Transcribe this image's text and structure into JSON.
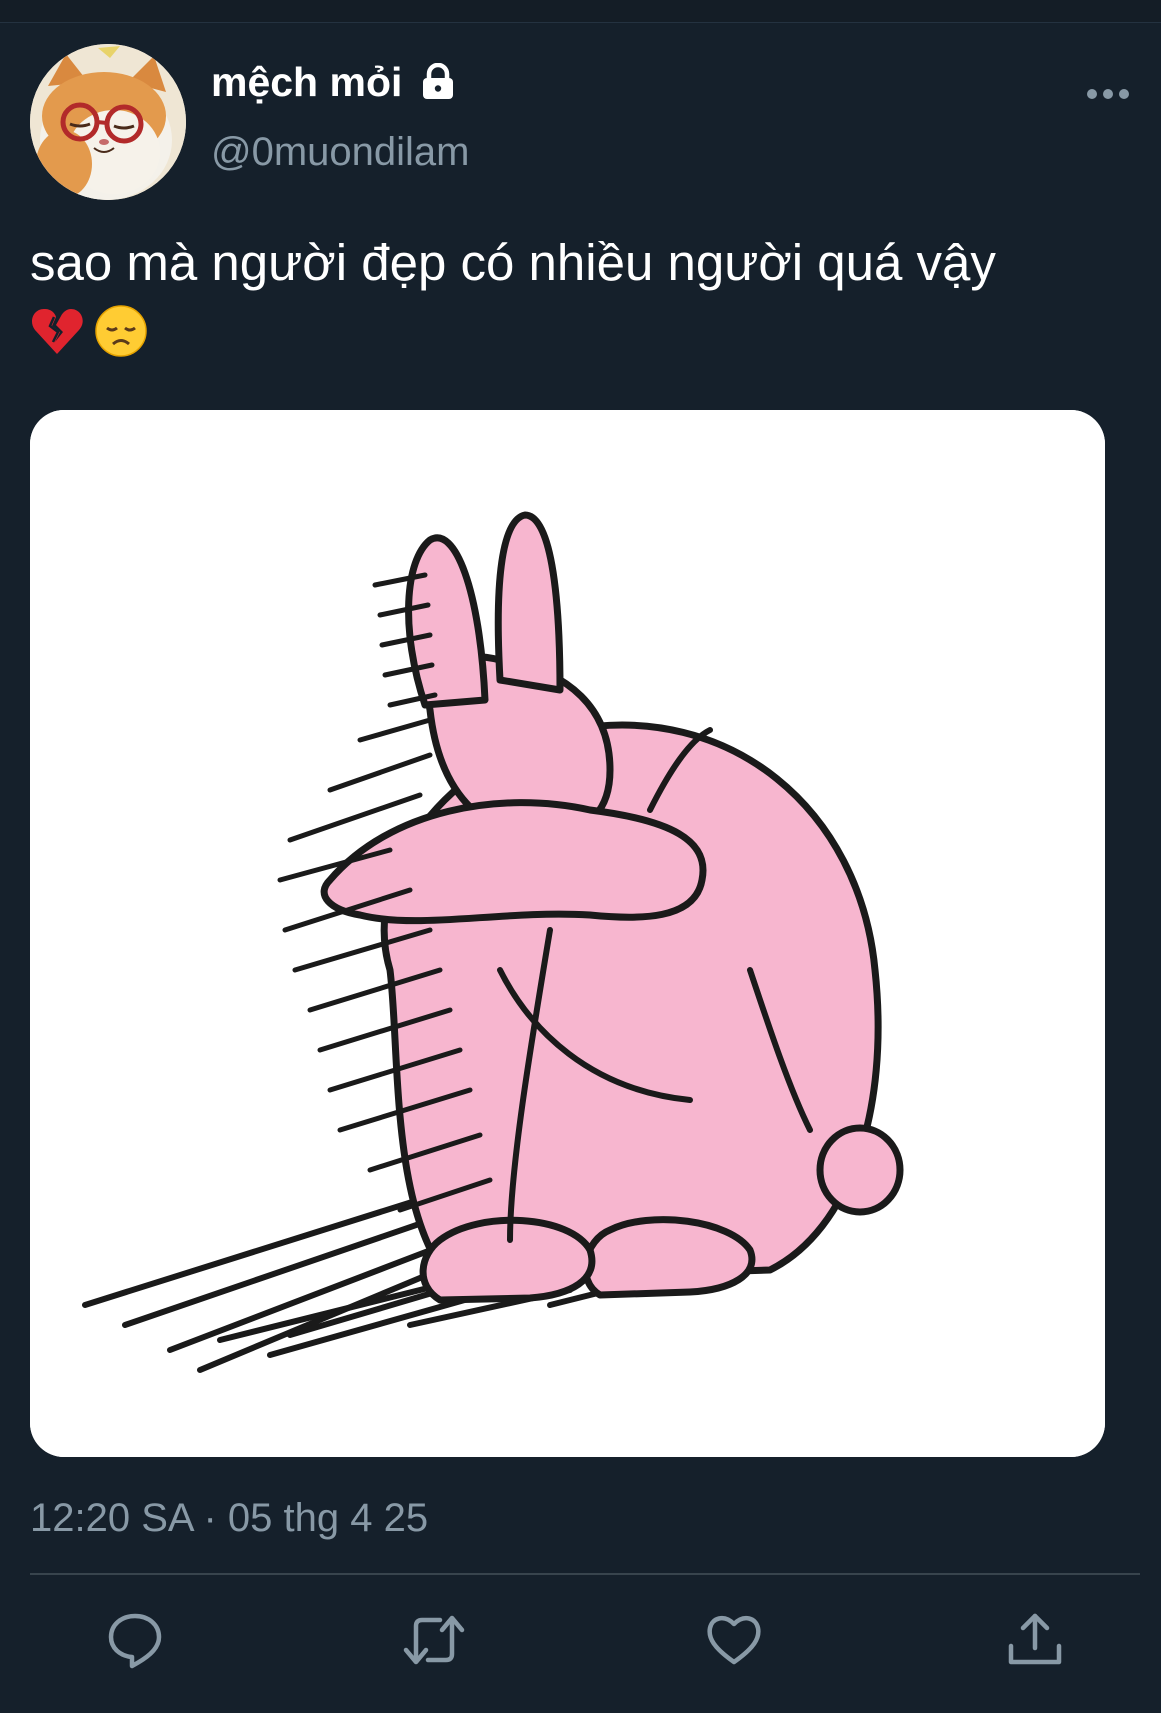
{
  "user": {
    "display_name": "mệch mỏi",
    "handle": "@0muondilam"
  },
  "tweet": {
    "text": "sao mà người đẹp có nhiều người quá vậy",
    "emojis": [
      "broken-heart-emoji",
      "disappointed-face-emoji"
    ],
    "timestamp": "12:20 SA · 05 thg 4 25"
  },
  "icons": {
    "lock": "lock-icon",
    "more": "more-icon",
    "reply": "reply-icon",
    "retweet": "retweet-icon",
    "like": "like-icon",
    "share": "share-icon"
  },
  "colors": {
    "background": "#15202b",
    "secondary_text": "#8899a6",
    "divider": "#38444d",
    "bunny_pink": "#f7b6cf"
  }
}
